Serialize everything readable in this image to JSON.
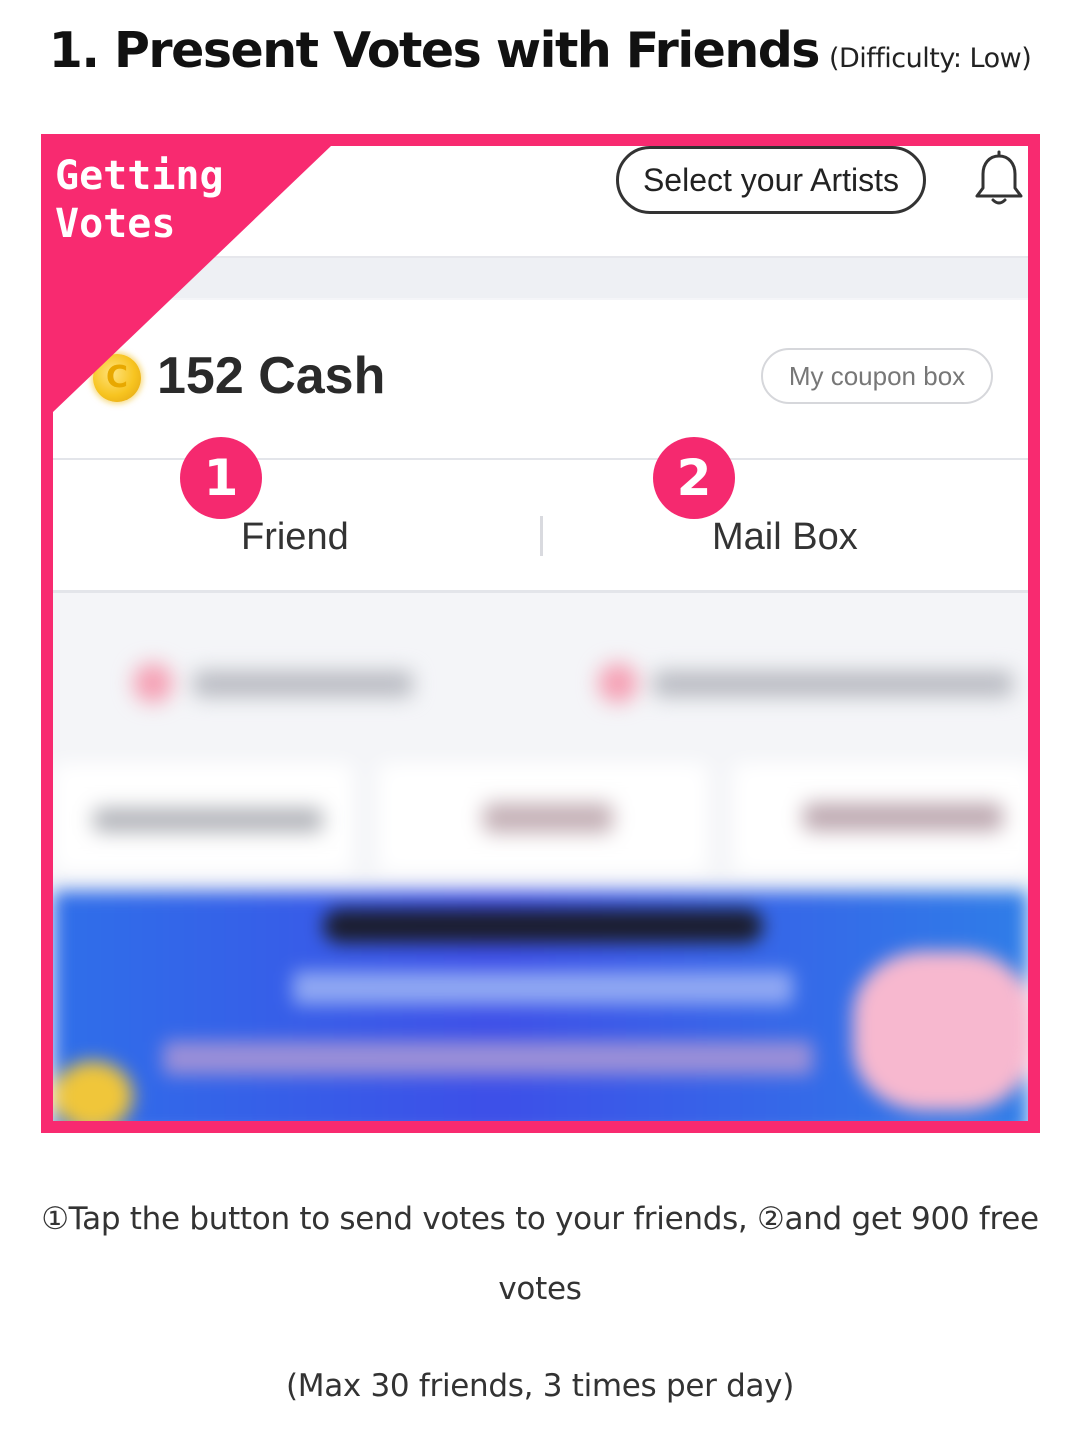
{
  "heading": {
    "title": "1. Present Votes with Friends",
    "difficulty": "(Difficulty: Low)"
  },
  "screenshot": {
    "ribbon": {
      "line1": "Getting",
      "line2": "Votes"
    },
    "header": {
      "artist_button_label": "Select your Artists",
      "bell_icon": "bell-icon"
    },
    "cash": {
      "coin_icon": "coin-icon",
      "coin_symbol": "C",
      "amount_label": "152 Cash",
      "coupon_button_label": "My coupon box"
    },
    "tabs": [
      {
        "label": "Friend",
        "step": "1"
      },
      {
        "label": "Mail Box",
        "step": "2"
      }
    ],
    "colors": {
      "accent_pink": "#f82a70",
      "banner_blue": "#3d4fe8"
    }
  },
  "caption": {
    "instruction": "①Tap the button to send votes to your friends, ②and get 900 free votes",
    "limit": "(Max 30 friends, 3 times per day)"
  }
}
